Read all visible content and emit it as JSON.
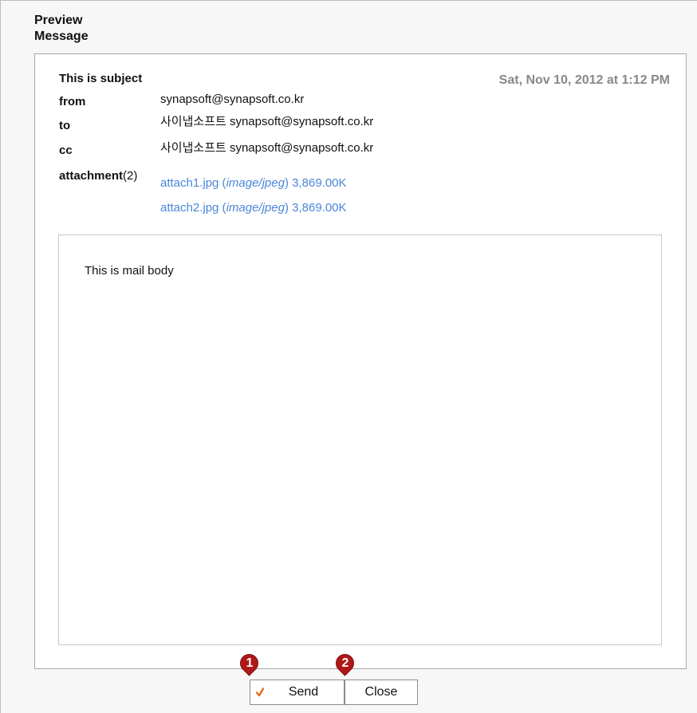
{
  "window": {
    "title_line1": "Preview",
    "title_line2": "Message"
  },
  "message": {
    "subject": "This is subject",
    "date": "Sat, Nov 10, 2012 at 1:12 PM",
    "from": {
      "label": "from",
      "value": "synapsoft@synapsoft.co.kr"
    },
    "to": {
      "label": "to",
      "value": "사이냅소프트 synapsoft@synapsoft.co.kr"
    },
    "cc": {
      "label": "cc",
      "value": "사이냅소프트 synapsoft@synapsoft.co.kr"
    },
    "attachments": {
      "label": "attachment",
      "count": "(2)",
      "items": [
        {
          "name": "attach1.jpg",
          "open": " (",
          "type": "image/jpeg",
          "close": ")",
          "size": "3,869.00K"
        },
        {
          "name": "attach2.jpg",
          "open": " (",
          "type": "image/jpeg",
          "close": ")",
          "size": "3,869.00K"
        }
      ]
    },
    "body": "This is mail body"
  },
  "buttons": {
    "send": "Send",
    "close": "Close"
  },
  "callouts": {
    "send_marker": "1",
    "close_marker": "2"
  },
  "colors": {
    "accent_link": "#4a86d9",
    "date_gray": "#888888",
    "marker_red": "#b01717",
    "check_orange": "#e46c1f"
  },
  "icons": {
    "send_check": "check-icon"
  }
}
